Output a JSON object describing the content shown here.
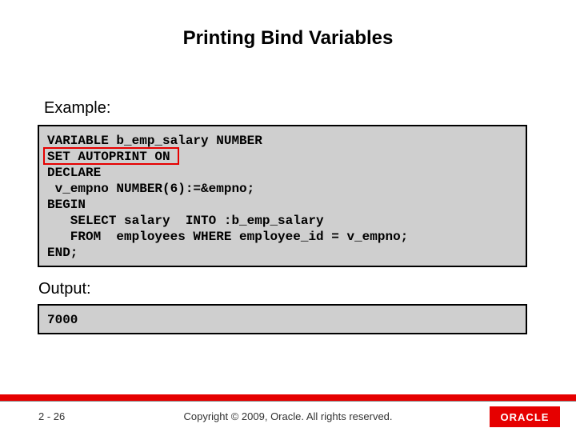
{
  "title": "Printing Bind Variables",
  "example_label": "Example:",
  "output_label": "Output:",
  "code": "VARIABLE b_emp_salary NUMBER\nSET AUTOPRINT ON\nDECLARE\n v_empno NUMBER(6):=&empno;\nBEGIN\n   SELECT salary  INTO :b_emp_salary\n   FROM  employees WHERE employee_id = v_empno;\nEND;",
  "output_value": "7000",
  "page_number": "2 - 26",
  "copyright": "Copyright © 2009, Oracle. All rights reserved.",
  "logo_text": "ORACLE"
}
